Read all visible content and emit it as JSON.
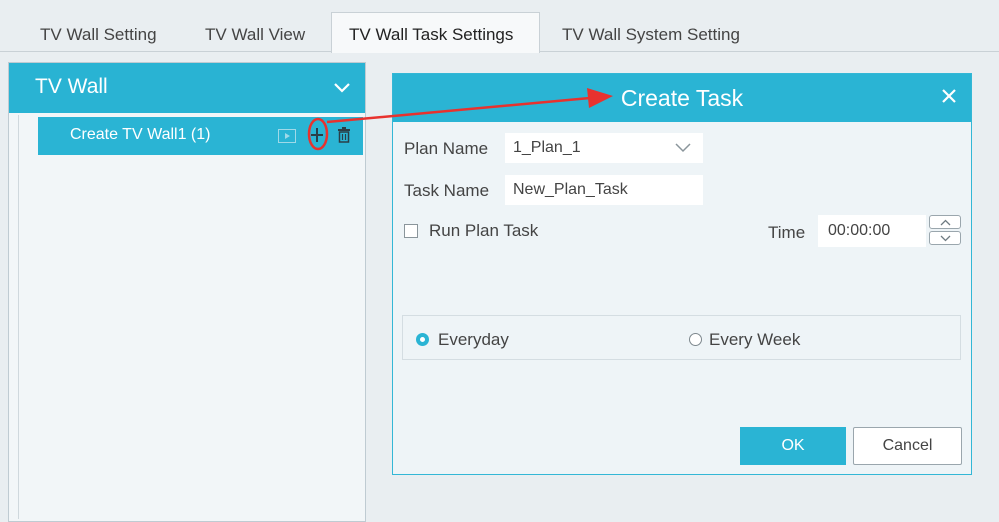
{
  "tabs": [
    {
      "label": "TV Wall Setting"
    },
    {
      "label": "TV Wall View"
    },
    {
      "label": "TV Wall Task Settings",
      "active": true
    },
    {
      "label": "TV Wall System Setting"
    }
  ],
  "left_panel": {
    "title": "TV Wall",
    "tree_item_label": "Create TV Wall1 (1)",
    "row_icons": [
      "play-icon",
      "add-icon",
      "delete-icon"
    ]
  },
  "dialog": {
    "title": "Create Task",
    "plan_name_label": "Plan Name",
    "plan_name_value": "1_Plan_1",
    "task_name_label": "Task Name",
    "task_name_value": "New_Plan_Task",
    "run_plan_task_label": "Run Plan Task",
    "run_plan_task_checked": false,
    "time_label": "Time",
    "time_value": "00:00:00",
    "frequency_options": [
      {
        "label": "Everyday",
        "selected": true
      },
      {
        "label": "Every Week",
        "selected": false
      }
    ],
    "ok_label": "OK",
    "cancel_label": "Cancel"
  },
  "colors": {
    "accent": "#2ab4d4",
    "annotation": "#e8322e",
    "background": "#e9eef1"
  }
}
